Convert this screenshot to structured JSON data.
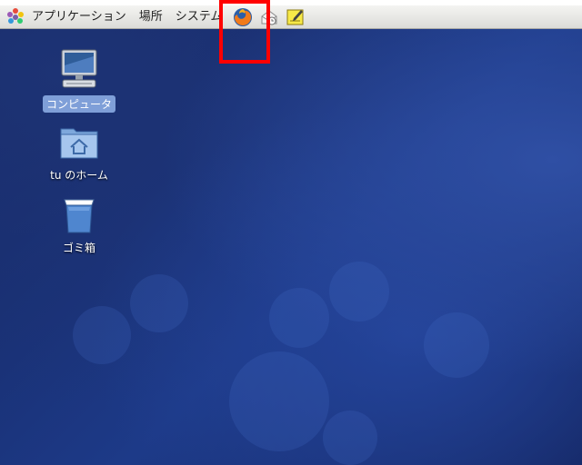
{
  "panel": {
    "menus": [
      {
        "label": "アプリケーション"
      },
      {
        "label": "場所"
      },
      {
        "label": "システム"
      }
    ],
    "launchers": [
      {
        "icon": "firefox-icon"
      },
      {
        "icon": "email-client-icon"
      },
      {
        "icon": "notes-icon"
      }
    ]
  },
  "desktop": {
    "icons": [
      {
        "label": "コンピュータ",
        "icon": "computer-icon",
        "selected": true
      },
      {
        "label": "tu のホーム",
        "icon": "home-folder-icon",
        "selected": false
      },
      {
        "label": "ゴミ箱",
        "icon": "trash-icon",
        "selected": false
      }
    ]
  },
  "colors": {
    "accent": "#ff0000",
    "selection": "#7f9fd8",
    "desktop_bg": "#1a2d6a"
  }
}
